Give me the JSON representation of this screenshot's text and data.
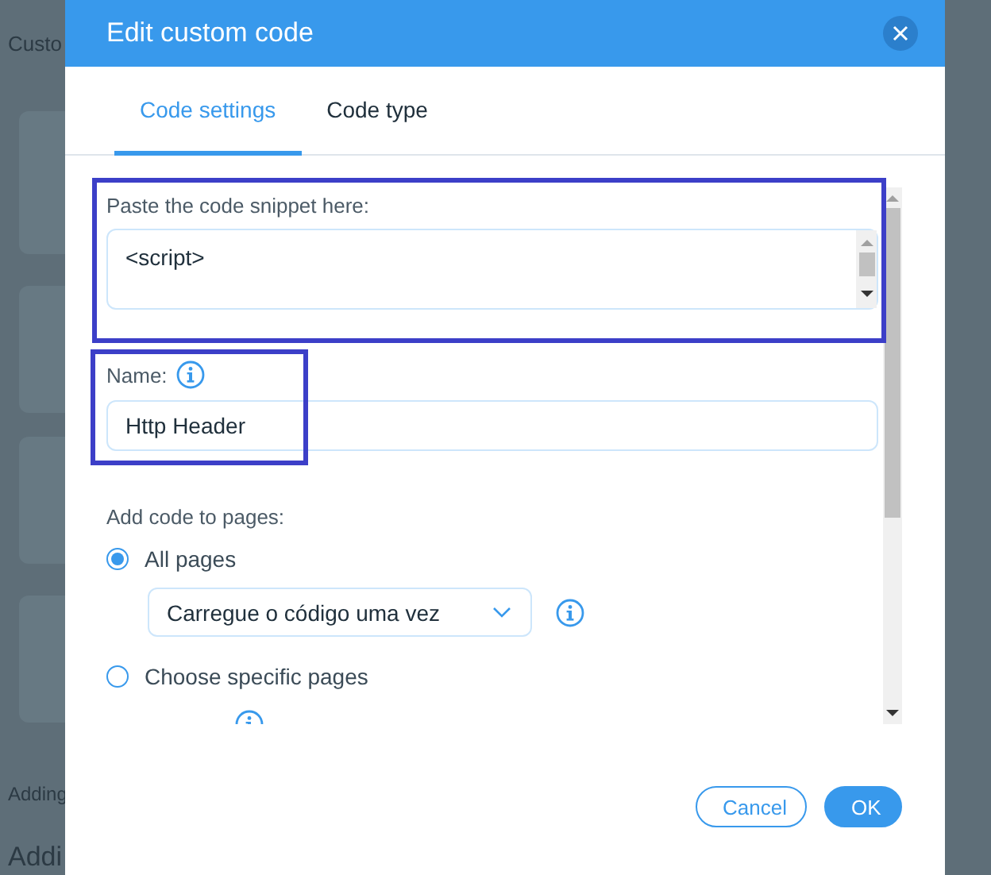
{
  "background": {
    "heading": "Custo",
    "section_label": "Adding",
    "section_title": "Addi"
  },
  "dialog": {
    "title": "Edit custom code",
    "tabs": [
      {
        "label": "Code settings",
        "selected": true
      },
      {
        "label": "Code type",
        "selected": false
      }
    ],
    "snippet": {
      "label": "Paste the code snippet here:",
      "value": "<script>"
    },
    "name": {
      "label": "Name:",
      "value": "Http Header"
    },
    "pages": {
      "label": "Add code to pages:",
      "options": [
        {
          "label": "All pages",
          "selected": true
        },
        {
          "label": "Choose specific pages",
          "selected": false
        }
      ],
      "load_select": {
        "value": "Carregue o código uma vez"
      }
    },
    "buttons": [
      {
        "label": "Cancel",
        "kind": "secondary"
      },
      {
        "label": "OK",
        "kind": "primary"
      }
    ]
  },
  "highlights": {
    "snippet": true,
    "name": true
  }
}
